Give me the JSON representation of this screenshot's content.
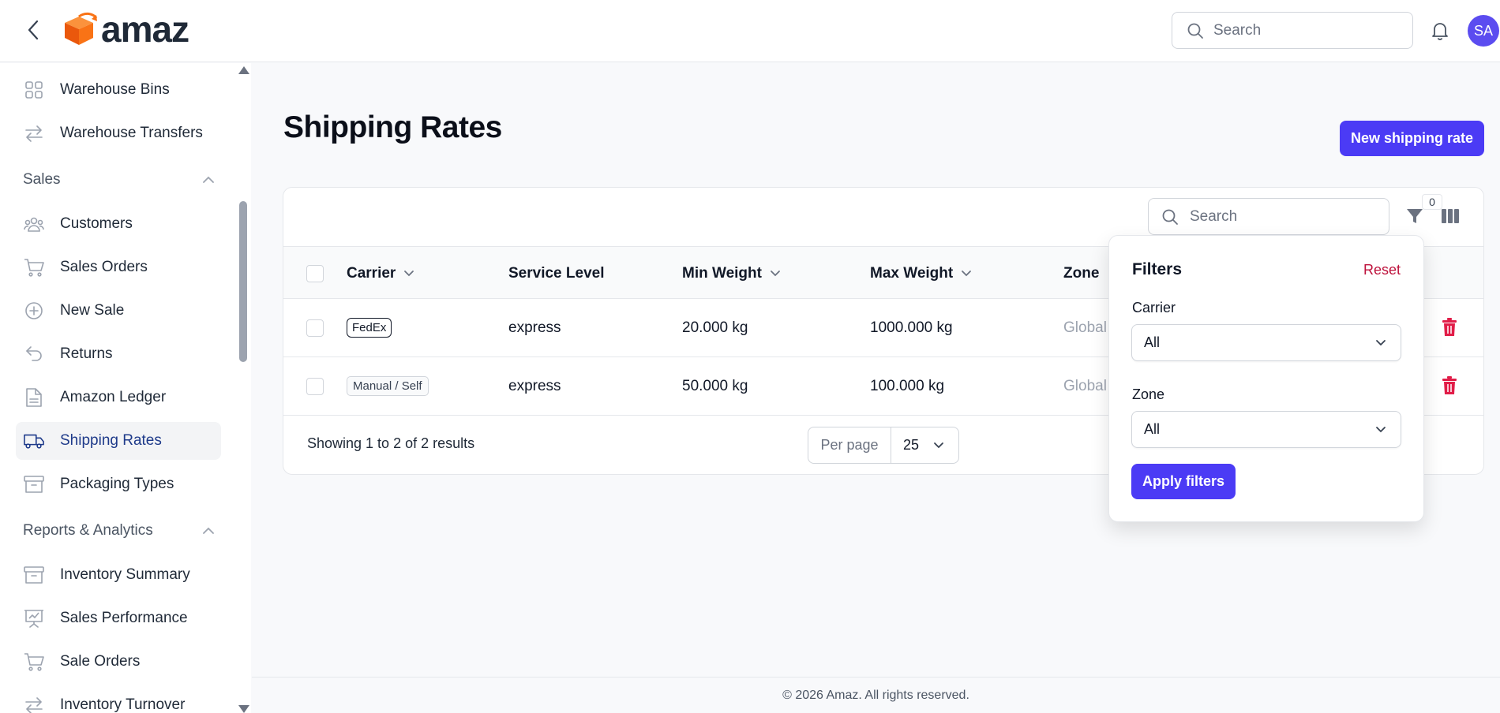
{
  "brand": {
    "name": "amaz",
    "accent": "#4b3bf5",
    "logo_accent": "#f97316"
  },
  "topbar": {
    "search_placeholder": "Search",
    "avatar_initials": "SA"
  },
  "sidebar": {
    "items_top": [
      {
        "label": "Warehouse Bins",
        "icon": "grid-icon"
      },
      {
        "label": "Warehouse Transfers",
        "icon": "arrows-swap-icon"
      }
    ],
    "sections": [
      {
        "title": "Sales",
        "items": [
          {
            "label": "Customers",
            "icon": "users-icon"
          },
          {
            "label": "Sales Orders",
            "icon": "cart-icon"
          },
          {
            "label": "New Sale",
            "icon": "plus-circle-icon"
          },
          {
            "label": "Returns",
            "icon": "return-arrow-icon"
          },
          {
            "label": "Amazon Ledger",
            "icon": "document-icon"
          },
          {
            "label": "Shipping Rates",
            "icon": "truck-icon",
            "active": true
          },
          {
            "label": "Packaging Types",
            "icon": "archive-box-icon"
          }
        ]
      },
      {
        "title": "Reports & Analytics",
        "items": [
          {
            "label": "Inventory Summary",
            "icon": "archive-box-icon"
          },
          {
            "label": "Sales Performance",
            "icon": "presentation-chart-icon"
          },
          {
            "label": "Sale Orders",
            "icon": "cart-icon"
          },
          {
            "label": "Inventory Turnover",
            "icon": "arrows-swap-icon"
          }
        ]
      }
    ]
  },
  "main": {
    "title": "Shipping Rates",
    "new_button": "New shipping rate",
    "table_search_placeholder": "Search",
    "active_filter_count": "0",
    "columns": {
      "carrier": "Carrier",
      "service_level": "Service Level",
      "min_weight": "Min Weight",
      "max_weight": "Max Weight",
      "zone": "Zone"
    },
    "rows": [
      {
        "carrier": "FedEx",
        "service_level": "express",
        "min_weight": "20.000 kg",
        "max_weight": "1000.000 kg",
        "zone": "Global"
      },
      {
        "carrier": "Manual / Self",
        "service_level": "express",
        "min_weight": "50.000 kg",
        "max_weight": "100.000 kg",
        "zone": "Global"
      }
    ],
    "results_text": "Showing 1 to 2 of 2 results",
    "per_page_label": "Per page",
    "per_page_value": "25"
  },
  "filters": {
    "title": "Filters",
    "reset": "Reset",
    "carrier_label": "Carrier",
    "carrier_value": "All",
    "zone_label": "Zone",
    "zone_value": "All",
    "apply": "Apply filters"
  },
  "footer": {
    "text": "© 2026 Amaz. All rights reserved."
  }
}
